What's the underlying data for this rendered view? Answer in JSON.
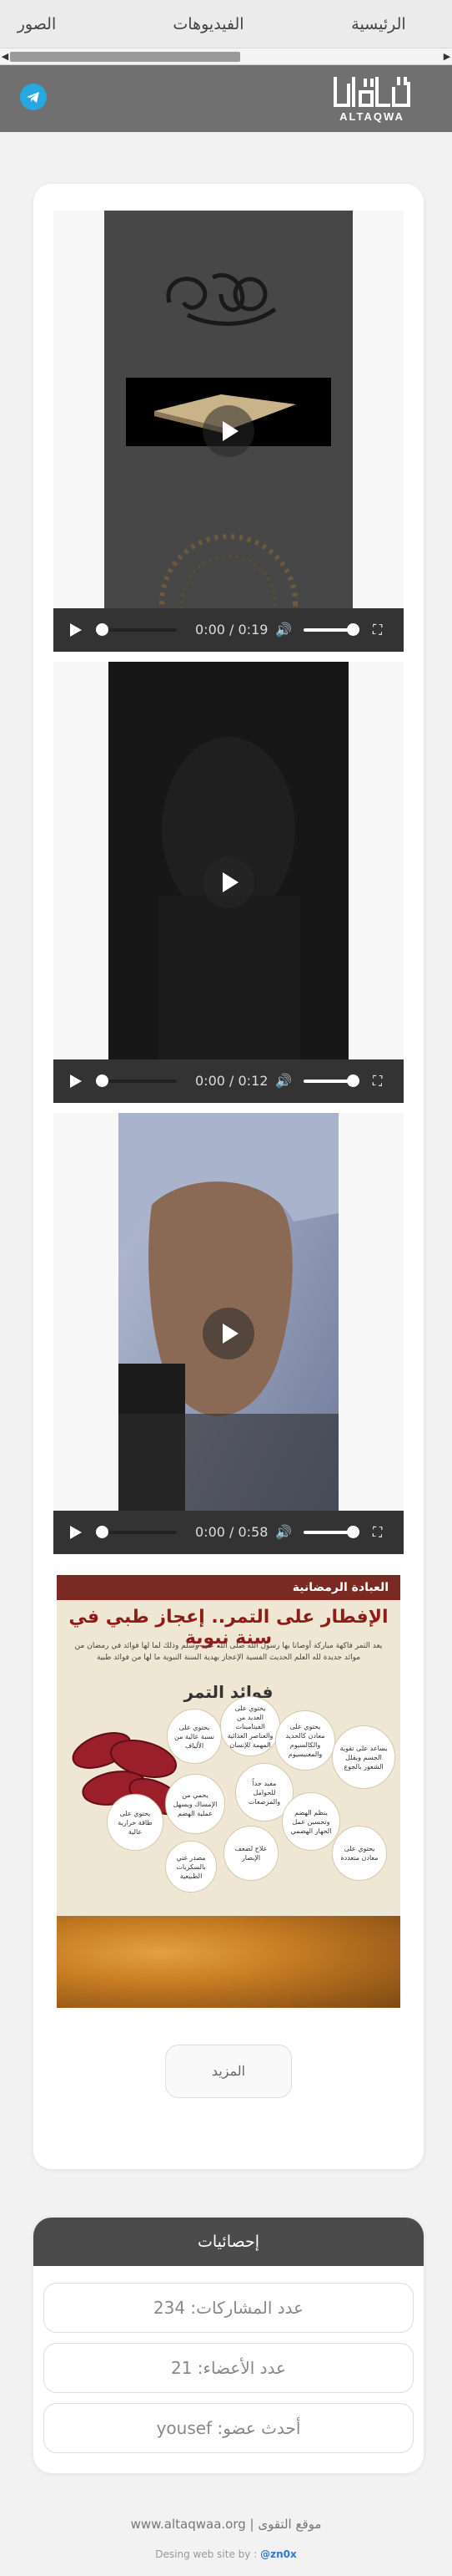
{
  "nav": {
    "items": [
      {
        "label": "الرئيسية"
      },
      {
        "label": "الفيديوهات"
      },
      {
        "label": "الصور"
      }
    ]
  },
  "header": {
    "logo_text": "التقوى",
    "logo_latin": "ALTAQWA",
    "telegram_icon": "telegram-icon",
    "telegram_color": "#28a8e0"
  },
  "videos": [
    {
      "time": "0:00 / 0:19",
      "progress": 0
    },
    {
      "time": "0:00 / 0:12",
      "progress": 0
    },
    {
      "time": "0:00 / 0:58",
      "progress": 0
    }
  ],
  "poster": {
    "band": "العبادة الرمضانية",
    "title": "الإفطار على التمر.. إعجاز طبي في سنة نبوية",
    "intro": "يعد التمر فاكهة مباركة أوصانا بها رسول الله صلى الله عليه وسلم وذلك لما لها فوائد في رمضان من موائد جديدة لله العلم الحديث الفسية الإعجاز بهدية السنة النبوية ما لها من فوائد طبية",
    "subtitle": "فوائد التمر",
    "bubbles": [
      "يحتوي على العديد من الفيتامينات والعناصر الغذائية المهمة للإنسان",
      "يحتوي على نسبة عالية من الألياف",
      "يحتوي على معادن كالحديد والكالسيوم والمغنيسيوم",
      "يساعد على تقوية الجسم ويقلل الشعور بالجوع",
      "مفيد جداً للحوامل والمرضعات",
      "يحمي من الإمساك ويسهل عملية الهضم",
      "يحتوي على طاقة حرارية عالية",
      "ينظم الهضم وتحسين عمل الجهاز الهضمي",
      "علاج لضعف الإبصار",
      "مصدر غني بالسكريات الطبيعية",
      "يحتوي على معادن متعددة"
    ]
  },
  "more_button": "المزيد",
  "stats": {
    "title": "إحصائيات",
    "posts": "عدد المشاركات: 234",
    "members": "عدد الأعضاء: 21",
    "newest": "أحدث عضو: yousef"
  },
  "footer": {
    "site": "موقع التقوى | www.altaqwaa.org",
    "credit": "Desing web site by :",
    "author": "@zn0x"
  }
}
